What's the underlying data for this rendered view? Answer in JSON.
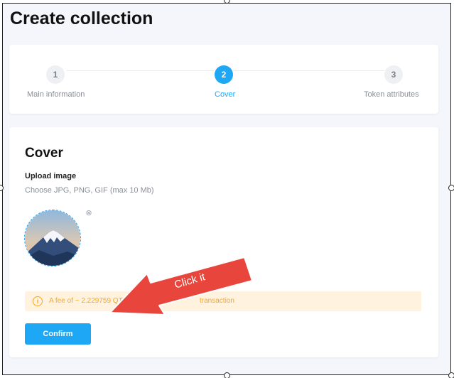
{
  "page": {
    "title": "Create collection"
  },
  "steps": [
    {
      "number": "1",
      "label": "Main information",
      "state": "inactive"
    },
    {
      "number": "2",
      "label": "Cover",
      "state": "active"
    },
    {
      "number": "3",
      "label": "Token attributes",
      "state": "inactive"
    }
  ],
  "cover": {
    "heading": "Cover",
    "upload_label": "Upload image",
    "upload_help": "Choose JPG, PNG, GIF (max 10 Mb)",
    "preview_icon": "mountain-image",
    "remove_icon": "close-circle-icon"
  },
  "fee": {
    "icon": "info-icon",
    "text_visible_start": "A fee of ~ 2.229759 QT",
    "text_visible_end": "transaction"
  },
  "actions": {
    "confirm_label": "Confirm"
  },
  "annotation": {
    "label": "Click it",
    "color": "#e8453c"
  },
  "colors": {
    "accent": "#1ea7f5",
    "warning": "#f5a623",
    "warning_bg": "#fff3e0"
  }
}
